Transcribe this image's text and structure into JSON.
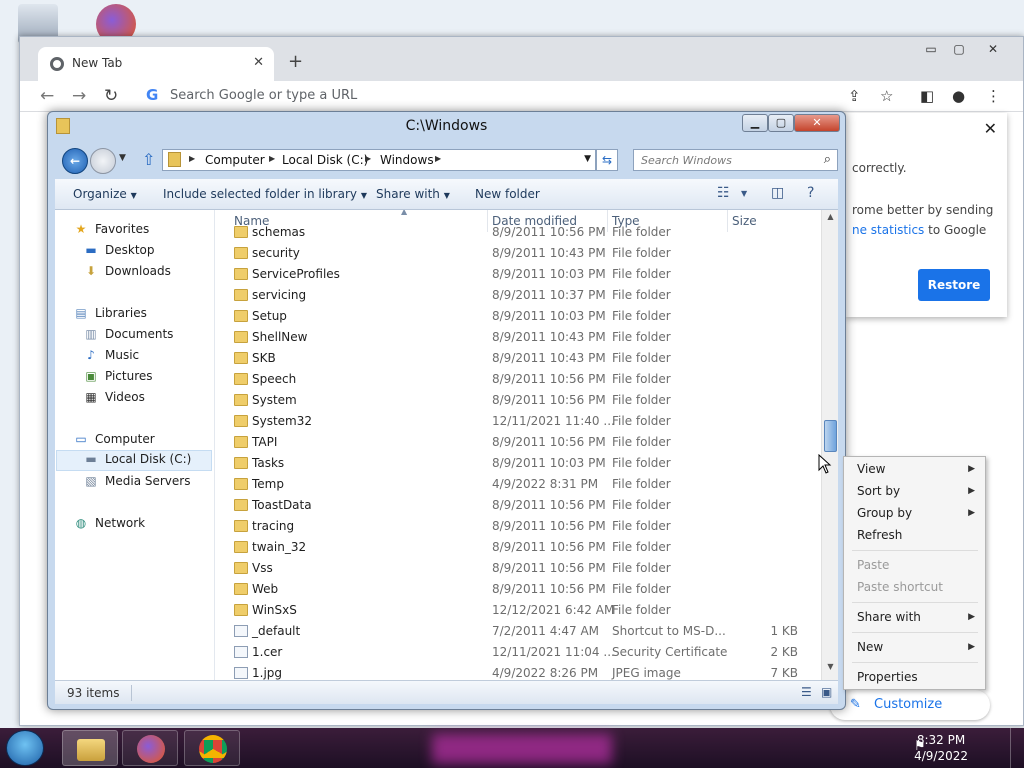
{
  "chrome": {
    "tab_title": "New Tab",
    "omnibox_placeholder": "Search Google or type a URL",
    "popup": {
      "line1": "correctly.",
      "line2": "rome better by sending",
      "line3_link": "ne statistics",
      "line3_rest": " to Google",
      "restore_label": "Restore"
    },
    "customize_label": "Customize Chrome"
  },
  "explorer": {
    "title": "C:\\Windows",
    "breadcrumb": [
      "Computer",
      "Local Disk (C:)",
      "Windows"
    ],
    "search_placeholder": "Search Windows",
    "toolbar": {
      "organize": "Organize",
      "include": "Include selected folder in library",
      "share": "Share with",
      "new_folder": "New folder"
    },
    "nav": {
      "favorites": "Favorites",
      "desktop": "Desktop",
      "downloads": "Downloads",
      "libraries": "Libraries",
      "documents": "Documents",
      "music": "Music",
      "pictures": "Pictures",
      "videos": "Videos",
      "computer": "Computer",
      "local_disk": "Local Disk (C:)",
      "media_servers": "Media Servers",
      "network": "Network"
    },
    "columns": {
      "name": "Name",
      "date": "Date modified",
      "type": "Type",
      "size": "Size"
    },
    "files": [
      {
        "name": "schemas",
        "date": "8/9/2011 10:56 PM",
        "type": "File folder",
        "size": "",
        "icon": "folder"
      },
      {
        "name": "security",
        "date": "8/9/2011 10:43 PM",
        "type": "File folder",
        "size": "",
        "icon": "folder"
      },
      {
        "name": "ServiceProfiles",
        "date": "8/9/2011 10:03 PM",
        "type": "File folder",
        "size": "",
        "icon": "folder"
      },
      {
        "name": "servicing",
        "date": "8/9/2011 10:37 PM",
        "type": "File folder",
        "size": "",
        "icon": "folder"
      },
      {
        "name": "Setup",
        "date": "8/9/2011 10:03 PM",
        "type": "File folder",
        "size": "",
        "icon": "folder"
      },
      {
        "name": "ShellNew",
        "date": "8/9/2011 10:43 PM",
        "type": "File folder",
        "size": "",
        "icon": "folder"
      },
      {
        "name": "SKB",
        "date": "8/9/2011 10:43 PM",
        "type": "File folder",
        "size": "",
        "icon": "folder"
      },
      {
        "name": "Speech",
        "date": "8/9/2011 10:56 PM",
        "type": "File folder",
        "size": "",
        "icon": "folder"
      },
      {
        "name": "System",
        "date": "8/9/2011 10:56 PM",
        "type": "File folder",
        "size": "",
        "icon": "folder"
      },
      {
        "name": "System32",
        "date": "12/11/2021 11:40 ...",
        "type": "File folder",
        "size": "",
        "icon": "folder"
      },
      {
        "name": "TAPI",
        "date": "8/9/2011 10:56 PM",
        "type": "File folder",
        "size": "",
        "icon": "folder"
      },
      {
        "name": "Tasks",
        "date": "8/9/2011 10:03 PM",
        "type": "File folder",
        "size": "",
        "icon": "folder"
      },
      {
        "name": "Temp",
        "date": "4/9/2022 8:31 PM",
        "type": "File folder",
        "size": "",
        "icon": "folder"
      },
      {
        "name": "ToastData",
        "date": "8/9/2011 10:56 PM",
        "type": "File folder",
        "size": "",
        "icon": "folder"
      },
      {
        "name": "tracing",
        "date": "8/9/2011 10:56 PM",
        "type": "File folder",
        "size": "",
        "icon": "folder"
      },
      {
        "name": "twain_32",
        "date": "8/9/2011 10:56 PM",
        "type": "File folder",
        "size": "",
        "icon": "folder"
      },
      {
        "name": "Vss",
        "date": "8/9/2011 10:56 PM",
        "type": "File folder",
        "size": "",
        "icon": "folder"
      },
      {
        "name": "Web",
        "date": "8/9/2011 10:56 PM",
        "type": "File folder",
        "size": "",
        "icon": "folder"
      },
      {
        "name": "WinSxS",
        "date": "12/12/2021 6:42 AM",
        "type": "File folder",
        "size": "",
        "icon": "folder"
      },
      {
        "name": "_default",
        "date": "7/2/2011 4:47 AM",
        "type": "Shortcut to MS-D...",
        "size": "1 KB",
        "icon": "shortcut"
      },
      {
        "name": "1.cer",
        "date": "12/11/2021 11:04 ...",
        "type": "Security Certificate",
        "size": "2 KB",
        "icon": "certificate"
      },
      {
        "name": "1.jpg",
        "date": "4/9/2022 8:26 PM",
        "type": "JPEG image",
        "size": "7 KB",
        "icon": "image"
      }
    ],
    "status_count": "93 items"
  },
  "context_menu": {
    "view": "View",
    "sort_by": "Sort by",
    "group_by": "Group by",
    "refresh": "Refresh",
    "paste": "Paste",
    "paste_shortcut": "Paste shortcut",
    "share_with": "Share with",
    "new": "New",
    "properties": "Properties"
  },
  "taskbar": {
    "time": "8:32 PM",
    "date": "4/9/2022"
  }
}
